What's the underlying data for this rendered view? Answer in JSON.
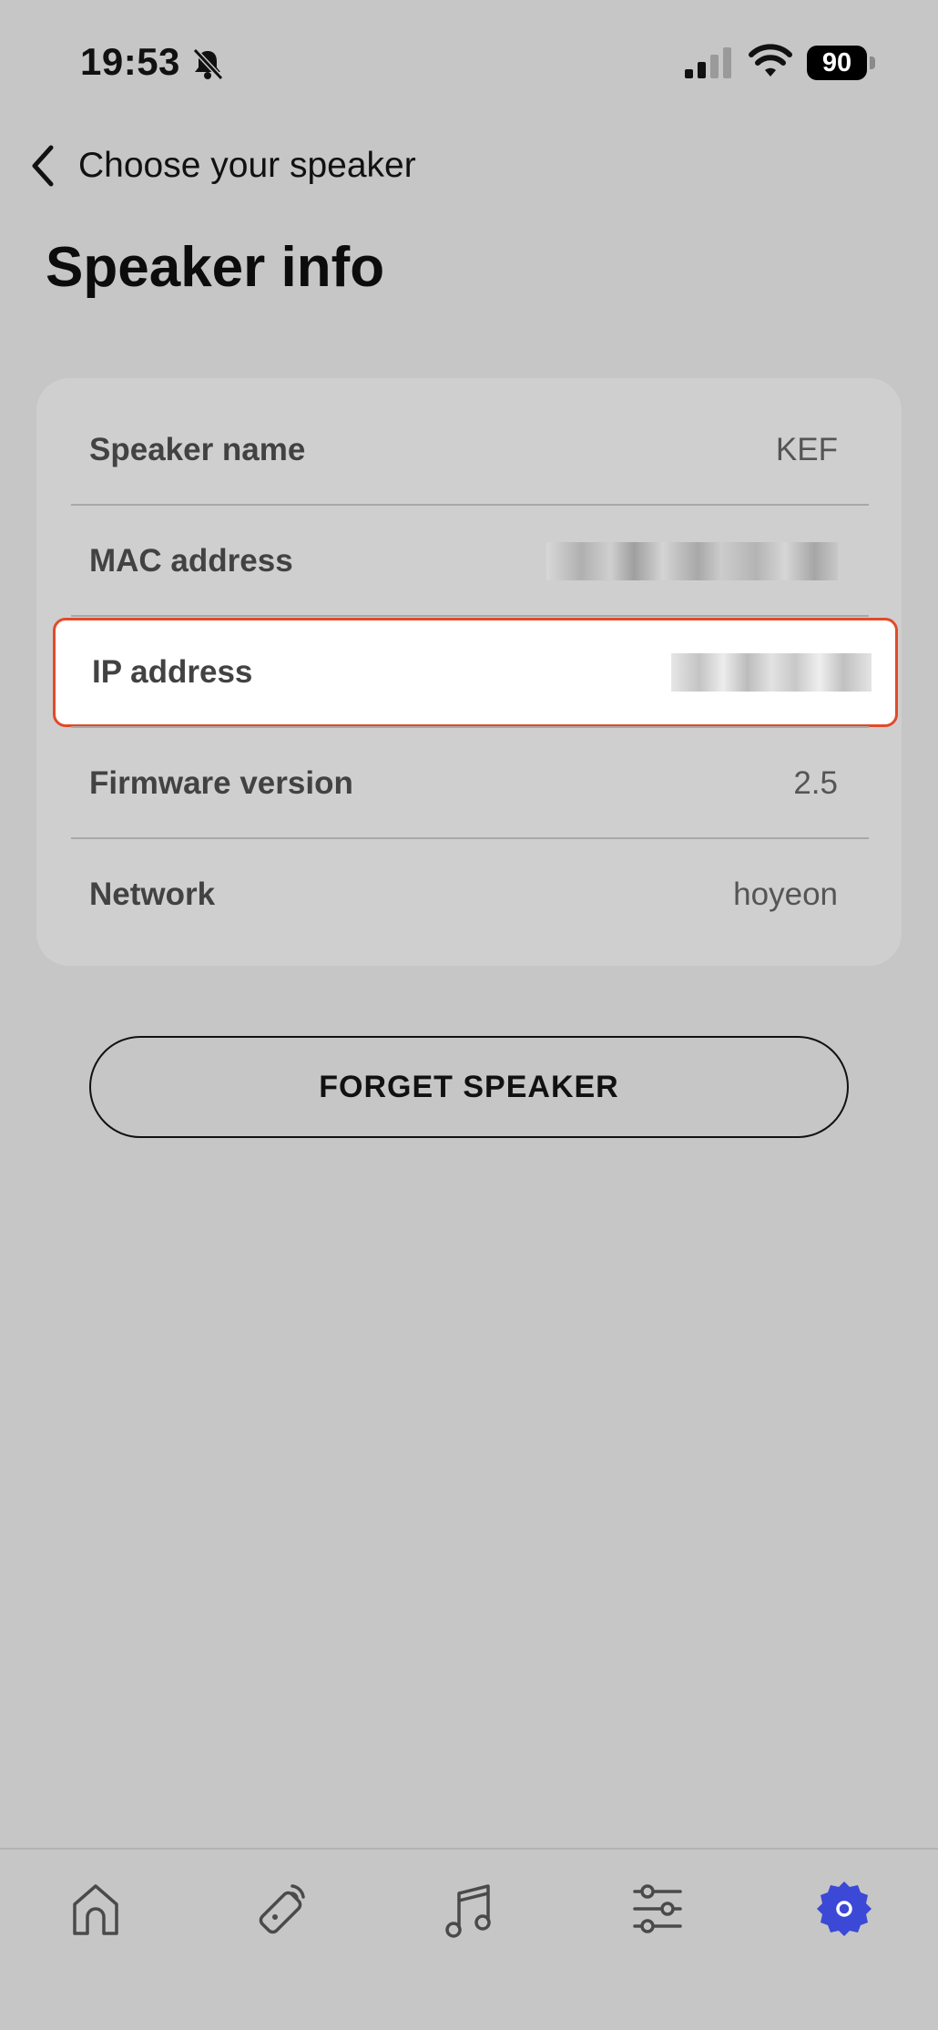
{
  "status_bar": {
    "time": "19:53",
    "battery_level": "90",
    "icons": [
      "bell-slash-icon",
      "cellular-signal-icon",
      "wifi-icon",
      "battery-icon"
    ]
  },
  "nav": {
    "back_label": "Choose your speaker"
  },
  "page": {
    "title": "Speaker info"
  },
  "info_rows": [
    {
      "label": "Speaker name",
      "value": "KEF"
    },
    {
      "label": "MAC address",
      "value": ""
    },
    {
      "label": "IP address",
      "value": ""
    },
    {
      "label": "Firmware version",
      "value": "2.5"
    },
    {
      "label": "Network",
      "value": "hoyeon"
    }
  ],
  "actions": {
    "forget_label": "FORGET SPEAKER"
  },
  "tab_bar": {
    "tabs": [
      "home-icon",
      "remote-icon",
      "music-icon",
      "sliders-icon",
      "settings-icon"
    ],
    "active": "settings-icon"
  },
  "colors": {
    "background": "#c6c6c6",
    "card": "#cfcfcf",
    "highlight_border": "#e24a2a",
    "accent": "#3b49d6"
  }
}
